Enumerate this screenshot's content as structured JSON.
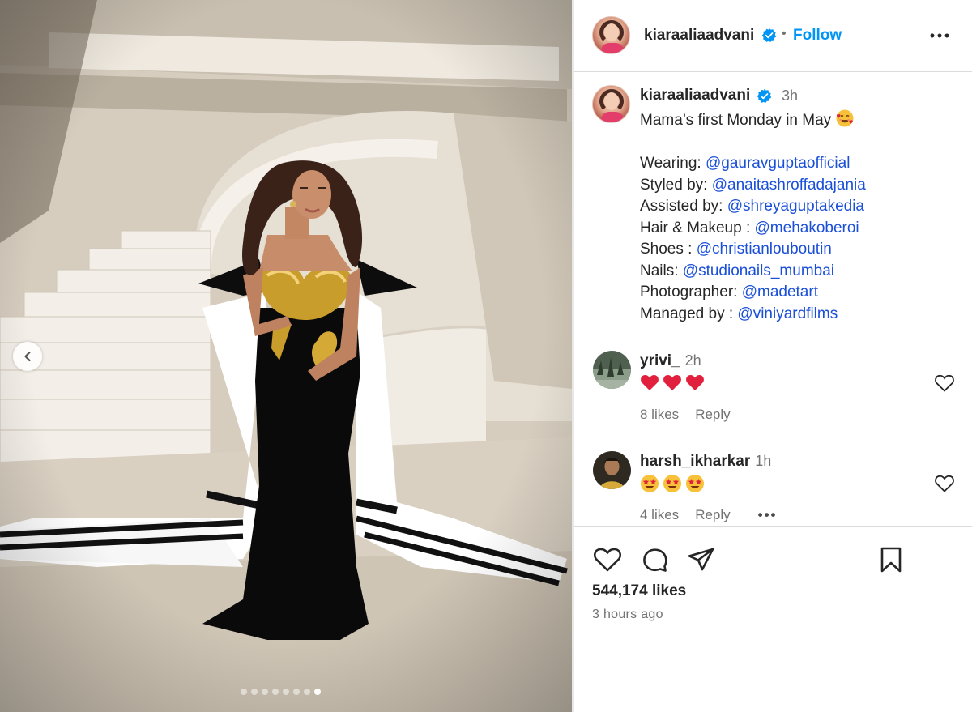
{
  "post": {
    "username": "kiaraaliaadvani",
    "follow_label": "Follow",
    "separator": "•",
    "caption_time": "3h",
    "caption_first_line": "Mama’s first Monday in May",
    "credits": [
      {
        "label": "Wearing:",
        "handle": "@gauravguptaofficial"
      },
      {
        "label": "Styled by:",
        "handle": "@anaitashroffadajania"
      },
      {
        "label": "Assisted by:",
        "handle": "@shreyaguptakedia"
      },
      {
        "label": "Hair & Makeup :",
        "handle": "@mehakoberoi"
      },
      {
        "label": "Shoes :",
        "handle": "@christianlouboutin"
      },
      {
        "label": "Nails:",
        "handle": "@studionails_mumbai"
      },
      {
        "label": "Photographer:",
        "handle": "@madetart"
      },
      {
        "label": "Managed by :",
        "handle": "@viniyardfilms"
      }
    ],
    "likes_count": "544,174 likes",
    "posted_ago": "3 hours ago"
  },
  "carousel": {
    "slide_count": 8,
    "active_slide_index": 7
  },
  "comments": [
    {
      "user": "yrivi_",
      "time": "2h",
      "emoji": [
        "heart-emoji",
        "heart-emoji",
        "heart-emoji"
      ],
      "likes": "8 likes",
      "reply": "Reply"
    },
    {
      "user": "harsh_ikharkar",
      "time": "1h",
      "emoji": [
        "star-struck-emoji",
        "star-struck-emoji",
        "star-struck-emoji"
      ],
      "likes": "4 likes",
      "reply": "Reply",
      "more": "•••"
    }
  ],
  "icons": [
    "chevron-left-icon",
    "verified-badge-icon",
    "more-options-icon",
    "heart-icon",
    "comment-icon",
    "share-icon",
    "bookmark-icon",
    "smiling-face-with-hearts-emoji"
  ],
  "colors": {
    "link": "#0095f6",
    "mention": "#1a4fd8",
    "secondary_text": "#737373",
    "divider": "#dbdbdb",
    "verified": "#0095f6",
    "heart_emoji": "#e0203c"
  }
}
